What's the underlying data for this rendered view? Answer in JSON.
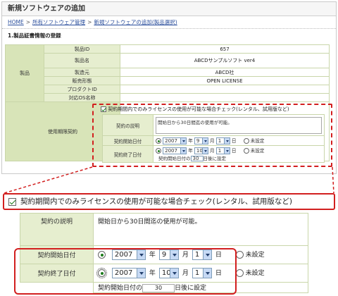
{
  "window": {
    "title": "新規ソフトウェアの追加"
  },
  "breadcrumb": {
    "items": [
      "HOME",
      "所有ソフトウェア管理",
      "新規ソフトウェアの追加(製品選択)"
    ],
    "separator": ">"
  },
  "section": {
    "title": "1.製品証書情報の登録"
  },
  "product": {
    "group_label": "製品",
    "rows": [
      {
        "label": "製品ID",
        "value": "657"
      },
      {
        "label": "製品名",
        "value": "ABCDサンプルソフト ver4"
      },
      {
        "label": "製造元",
        "value": "ABCD社"
      },
      {
        "label": "販売形態",
        "value": "OPEN LICENSE"
      },
      {
        "label": "プロダクトID",
        "value": ""
      },
      {
        "label": "対応OS名称",
        "value": ""
      }
    ]
  },
  "usage": {
    "label": "使用期限契約",
    "checkbox_label": "契約期間内でのみライセンスの使用が可能な場合チェック(レンタル、試用版など)",
    "checked": true,
    "description_label": "契約の説明",
    "description_value": "開始日から30日間迄の使用が可能。",
    "start": {
      "label": "契約開始日付",
      "year": "2007",
      "month": "9",
      "day": "1",
      "year_unit": "年",
      "month_unit": "月",
      "day_unit": "日",
      "unset_label": "未設定",
      "selected": "date"
    },
    "end": {
      "label": "契約終了日付",
      "year": "2007",
      "month": "10",
      "day": "1",
      "year_unit": "年",
      "month_unit": "月",
      "day_unit": "日",
      "unset_label": "未設定",
      "selected": "date"
    },
    "note_prefix_top": "契約開始日付の",
    "note_value_top": "30",
    "note_suffix_top": "日後に設定",
    "note_prefix_zoom": "契約開始日付の",
    "note_value_zoom": "30",
    "note_suffix_zoom": "日後に設定"
  },
  "colors": {
    "highlight_red": "#d21f1f",
    "table_header_green": "#d8e4b8",
    "table_label_green": "#e6eecf",
    "link_blue": "#2a4e9c",
    "radio_green": "#1a7a1a"
  }
}
